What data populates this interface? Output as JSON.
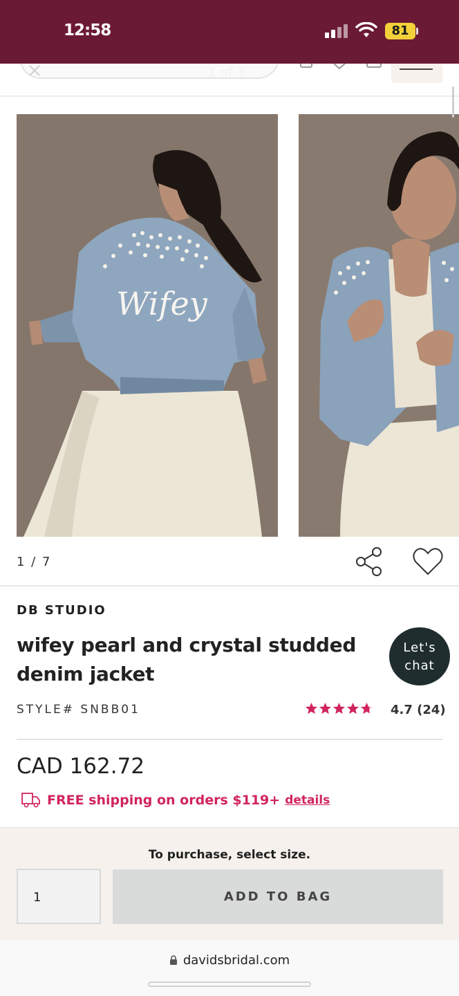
{
  "status": {
    "time": "12:58",
    "battery": "81"
  },
  "header": {
    "gallery_overlay": "1 of 3"
  },
  "gallery": {
    "pager": "1 / 7",
    "script_text": "Wifey"
  },
  "product": {
    "brand": "DB STUDIO",
    "title": "wifey pearl and crystal studded denim jacket",
    "style": "STYLE# SNBB01",
    "rating": "4.7 (24)",
    "rating_value": 4.7,
    "price": "CAD 162.72",
    "shipping": "FREE shipping on orders $119+",
    "shipping_link": "details"
  },
  "chat": {
    "line1": "Let's",
    "line2": "chat"
  },
  "purchase": {
    "note": "To purchase, select size.",
    "quantity": "1",
    "add_label": "ADD TO BAG"
  },
  "browser": {
    "url": "davidsbridal.com"
  },
  "colors": {
    "brand_bar": "#6b1a35",
    "accent_pink": "#d1245f",
    "chat_bg": "#1f2d2e",
    "button_gray": "#d9dada"
  },
  "icons": [
    "signal-icon",
    "wifi-icon",
    "battery-icon",
    "close-icon",
    "share-icon",
    "heart-icon",
    "star-icon",
    "truck-icon",
    "lock-icon",
    "menu-icon"
  ]
}
